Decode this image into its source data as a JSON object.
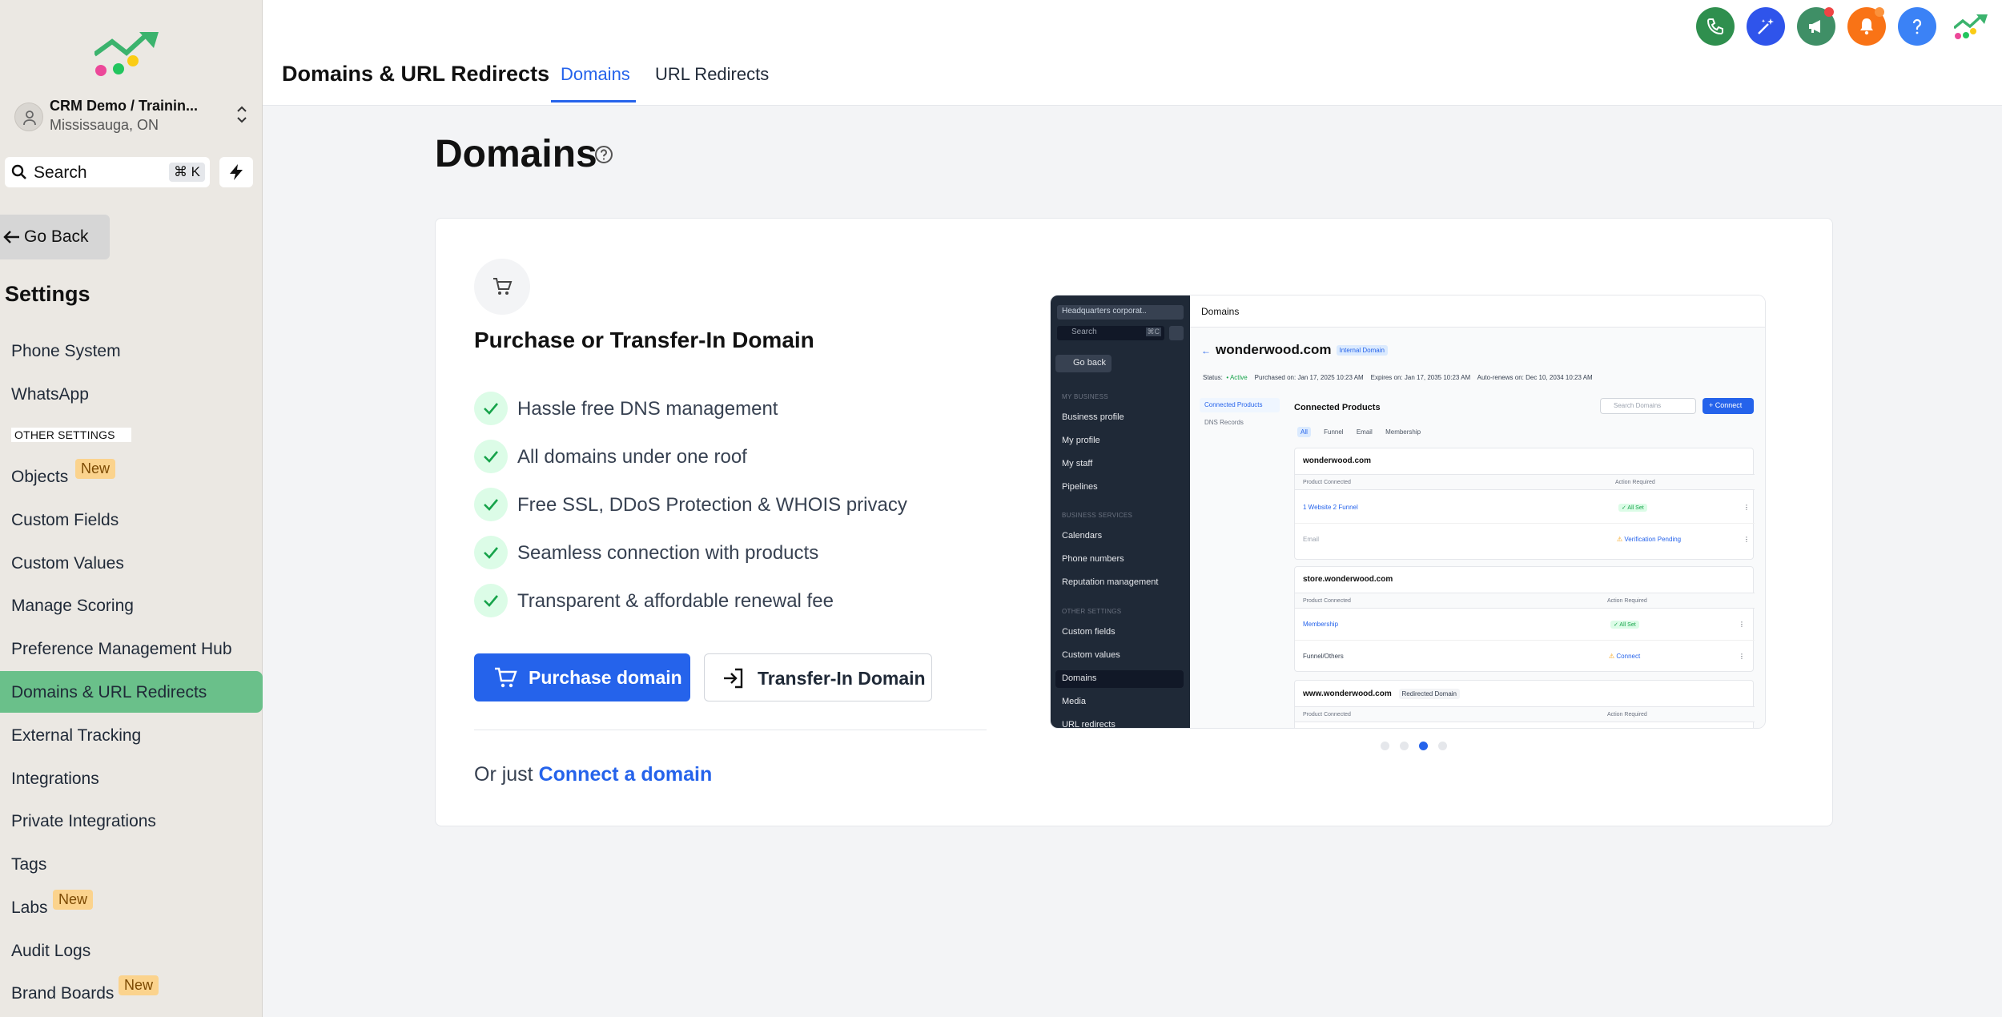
{
  "account": {
    "name": "CRM Demo / Trainin...",
    "location": "Mississauga, ON"
  },
  "search": {
    "label": "Search",
    "shortcut": "⌘ K"
  },
  "sidebar": {
    "go_back": "Go Back",
    "section_title": "Settings",
    "other_settings_label": "OTHER SETTINGS",
    "items": [
      {
        "label": "Phone System"
      },
      {
        "label": "WhatsApp"
      },
      {
        "label": "Objects",
        "badge": "New"
      },
      {
        "label": "Custom Fields"
      },
      {
        "label": "Custom Values"
      },
      {
        "label": "Manage Scoring"
      },
      {
        "label": "Preference Management Hub"
      },
      {
        "label": "Domains & URL Redirects",
        "active": true
      },
      {
        "label": "External Tracking"
      },
      {
        "label": "Integrations"
      },
      {
        "label": "Private Integrations"
      },
      {
        "label": "Tags"
      },
      {
        "label": "Labs",
        "badge": "New"
      },
      {
        "label": "Audit Logs"
      },
      {
        "label": "Brand Boards",
        "badge": "New"
      }
    ]
  },
  "header": {
    "title": "Domains & URL Redirects",
    "tabs": [
      {
        "label": "Domains",
        "active": true
      },
      {
        "label": "URL Redirects",
        "active": false
      }
    ],
    "icons": [
      {
        "name": "phone-icon",
        "color": "#2f8f4e"
      },
      {
        "name": "sparkle-icon",
        "color": "#2f54eb"
      },
      {
        "name": "megaphone-icon",
        "color": "#3f8f66"
      },
      {
        "name": "bell-icon",
        "color": "#f97316"
      },
      {
        "name": "help-icon",
        "color": "#3b82f6"
      }
    ]
  },
  "main": {
    "page_title": "Domains",
    "card": {
      "heading": "Purchase or Transfer-In Domain",
      "features": [
        "Hassle free DNS management",
        "All domains under one roof",
        "Free SSL, DDoS Protection & WHOIS privacy",
        "Seamless connection with products",
        "Transparent & affordable renewal fee"
      ],
      "purchase_button": "Purchase domain",
      "transfer_button": "Transfer-In Domain",
      "connect_prefix": "Or just",
      "connect_link": "Connect a domain"
    }
  },
  "preview": {
    "account": "Headquarters corporat..",
    "search": "Search",
    "shortcut": "⌘C",
    "go_back": "Go back",
    "sections": {
      "my_business": "MY BUSINESS",
      "business_services": "BUSINESS SERVICES",
      "other_settings": "OTHER SETTINGS"
    },
    "nav": {
      "business_profile": "Business profile",
      "my_profile": "My profile",
      "my_staff": "My staff",
      "pipelines": "Pipelines",
      "calendars": "Calendars",
      "phone_numbers": "Phone numbers",
      "reputation": "Reputation management",
      "custom_fields": "Custom fields",
      "custom_values": "Custom values",
      "domains": "Domains",
      "media": "Media",
      "url_redirects": "URL redirects"
    },
    "top_title": "Domains",
    "domain": "wonderwood.com",
    "domain_tag": "Internal Domain",
    "status_label": "Status:",
    "status_value": "• Active",
    "purchased": "Purchased on: Jan 17, 2025 10:23 AM",
    "expires": "Expires on: Jan 17, 2035 10:23 AM",
    "renews": "Auto-renews on: Dec 10, 2034 10:23 AM",
    "left_tabs": [
      "Connected Products",
      "DNS Records"
    ],
    "connected_products": "Connected Products",
    "search_domains": "Search Domains",
    "connect_button": "+ Connect",
    "filters": [
      "All",
      "Funnel",
      "Email",
      "Membership"
    ],
    "col_product": "Product Connected",
    "col_action": "Action Required",
    "cards": [
      {
        "name": "wonderwood.com",
        "rows": [
          {
            "product": "1 Website   2 Funnel",
            "action": "✓ All Set"
          },
          {
            "product": "Email",
            "action": "Verification Pending"
          }
        ]
      },
      {
        "name": "store.wonderwood.com",
        "rows": [
          {
            "product": "Membership",
            "action": "✓ All Set"
          },
          {
            "product": "Funnel/Others",
            "action": "Connect"
          }
        ]
      },
      {
        "name": "www.wonderwood.com",
        "tag": "Redirected Domain"
      }
    ]
  }
}
